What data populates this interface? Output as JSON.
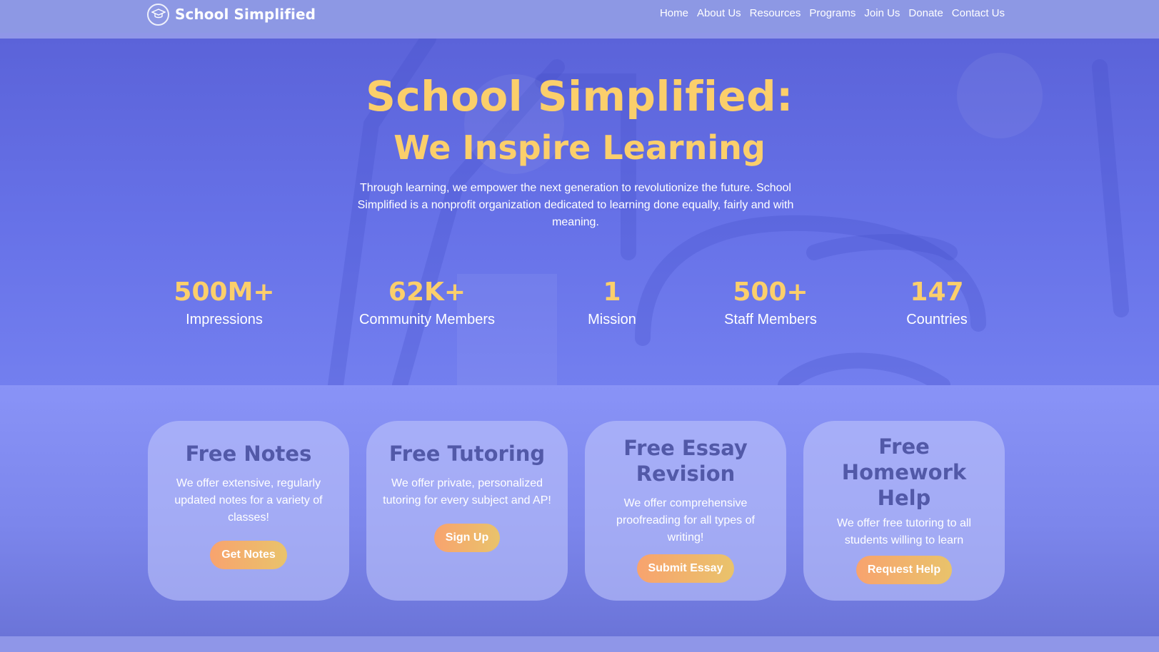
{
  "brand": {
    "name": "School Simplified",
    "logo_icon": "graduation-cap-icon"
  },
  "nav": {
    "links": [
      "Home",
      "About Us",
      "Resources",
      "Programs",
      "Join Us",
      "Donate",
      "Contact Us"
    ]
  },
  "hero": {
    "title": "School Simplified:",
    "subtitle": "We Inspire Learning",
    "description": "Through learning, we empower the next generation to revolutionize the future. School Simplified is a nonprofit organization dedicated to learning done equally, fairly and with meaning."
  },
  "stats": [
    {
      "value": "500M+",
      "label": "Impressions"
    },
    {
      "value": "62K+",
      "label": "Community Members"
    },
    {
      "value": "1",
      "label": "Mission"
    },
    {
      "value": "500+",
      "label": "Staff Members"
    },
    {
      "value": "147",
      "label": "Countries"
    }
  ],
  "services": [
    {
      "title": "Free Notes",
      "text": "We offer extensive, regularly updated notes for a variety of classes!",
      "button": "Get Notes"
    },
    {
      "title": "Free Tutoring",
      "text": "We offer private, personalized tutoring for every subject and AP!",
      "button": "Sign Up"
    },
    {
      "title": "Free Essay Revision",
      "text": "We offer comprehensive proofreading for all types of writing!",
      "button": "Submit Essay"
    },
    {
      "title": "Free Homework Help",
      "text": "We offer free tutoring to all students willing to learn",
      "button": "Request Help"
    }
  ],
  "colors": {
    "accent_yellow": "#fbcf6b",
    "nav_bg": "#8d98e4",
    "hero_bg": "#6470e6",
    "card_title": "#5259a8",
    "button_gradient_start": "#f8a36e",
    "button_gradient_end": "#e9c36b"
  }
}
